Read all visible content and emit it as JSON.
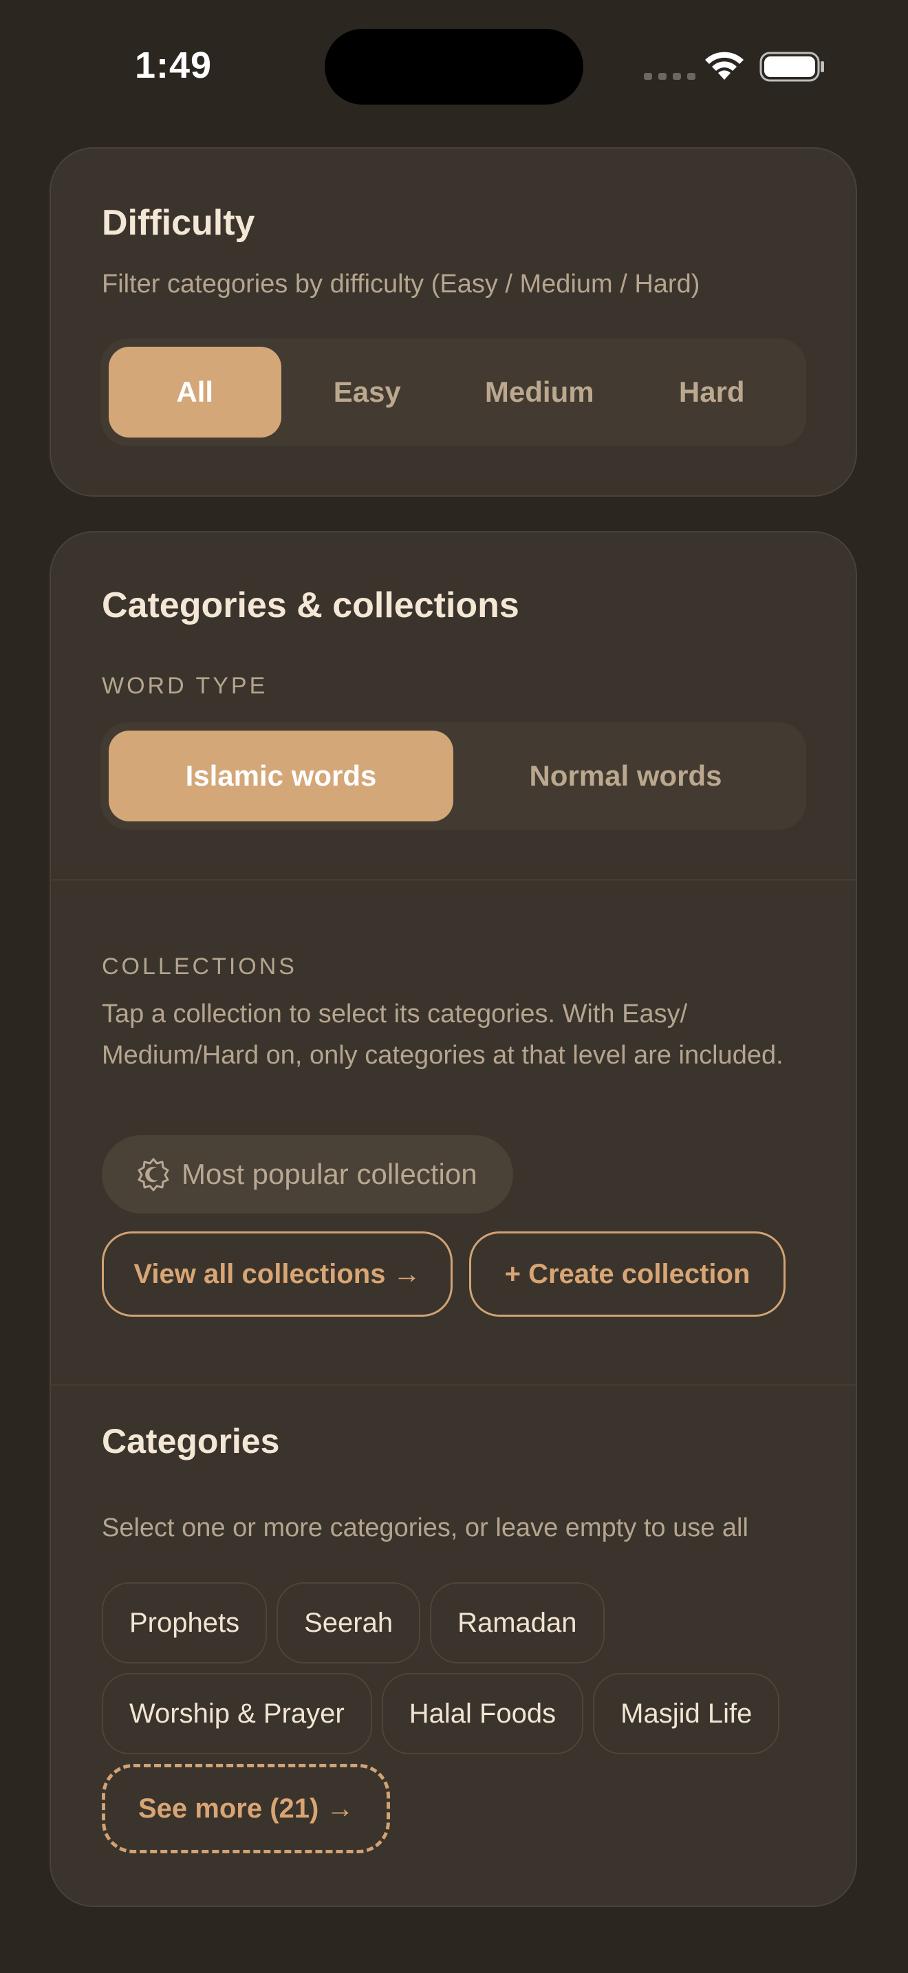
{
  "status_bar": {
    "time": "1:49"
  },
  "difficulty": {
    "title": "Difficulty",
    "subtitle": "Filter categories by difficulty (Easy / Medium / Hard)",
    "options": [
      {
        "label": "All",
        "selected": true
      },
      {
        "label": "Easy",
        "selected": false
      },
      {
        "label": "Medium",
        "selected": false
      },
      {
        "label": "Hard",
        "selected": false
      }
    ]
  },
  "categories_collections": {
    "title": "Categories & collections",
    "word_type": {
      "label": "WORD TYPE",
      "options": [
        {
          "label": "Islamic words",
          "selected": true
        },
        {
          "label": "Normal words",
          "selected": false
        }
      ]
    },
    "collections": {
      "label": "COLLECTIONS",
      "description": "Tap a collection to select its categories. With Easy/ Medium/Hard on, only categories at that level are included.",
      "popular_label": "Most popular collection",
      "view_all_label": "View all collections →",
      "create_label": "+ Create collection"
    },
    "categories": {
      "title": "Categories",
      "subtitle": "Select one or more categories, or leave empty to use all",
      "chips_row1": [
        "Prophets",
        "Seerah",
        "Ramadan"
      ],
      "chips_row2": [
        "Worship & Prayer",
        "Halal Foods",
        "Masjid Life"
      ],
      "see_more_label": "See more (21) →"
    }
  },
  "colors": {
    "background": "#2b2620",
    "card": "#3a342c",
    "accent": "#d4a778",
    "muted_text": "#b5a58f"
  }
}
